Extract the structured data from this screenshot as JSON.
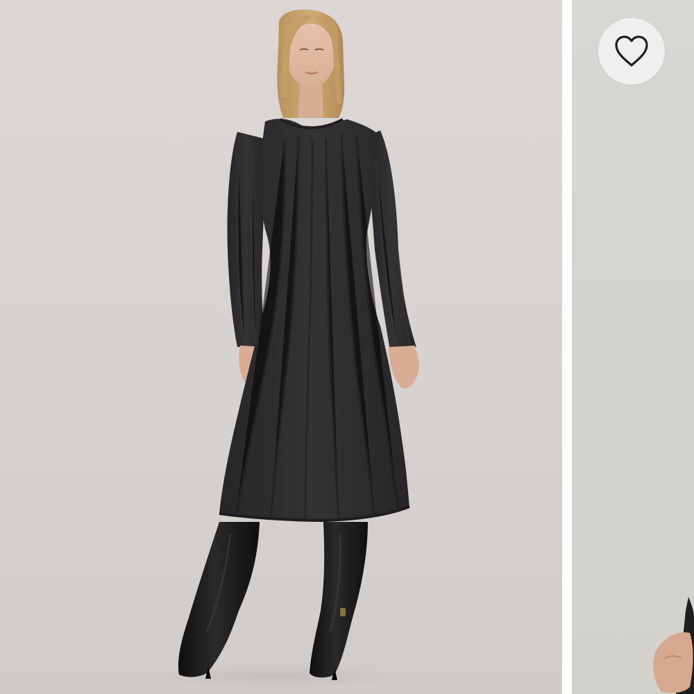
{
  "gallery": {
    "main_image": {
      "alt": "",
      "icon": "product-photo"
    },
    "next_image": {
      "alt": "",
      "icon": "product-photo"
    },
    "favorite_button": {
      "icon": "heart-outline-icon",
      "label": ""
    }
  },
  "colors": {
    "background_main": "#d8d4d2",
    "background_next": "#d6d4cf",
    "dress": "#2c2c2e",
    "boots": "#151515",
    "favorite_button_bg": "#efefef",
    "heart_stroke": "#1f1f1f"
  }
}
